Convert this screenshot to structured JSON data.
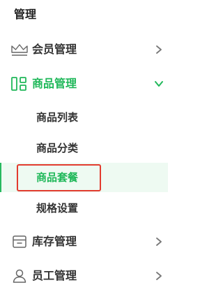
{
  "section": {
    "title": "管理"
  },
  "groups": [
    {
      "label": "会员管理",
      "icon": "crown-icon",
      "expanded": false
    },
    {
      "label": "商品管理",
      "icon": "layout-grid-icon",
      "expanded": true,
      "children": [
        "商品列表",
        "商品分类",
        "商品套餐",
        "规格设置"
      ],
      "selected_child": "商品套餐"
    },
    {
      "label": "库存管理",
      "icon": "box-icon",
      "expanded": false
    },
    {
      "label": "员工管理",
      "icon": "user-icon",
      "expanded": false
    }
  ],
  "colors": {
    "accent": "#20b85a",
    "selected_bg": "#eefaf2",
    "highlight_outline": "#e23b2e",
    "text": "#333333",
    "icon_gray": "#666666"
  }
}
